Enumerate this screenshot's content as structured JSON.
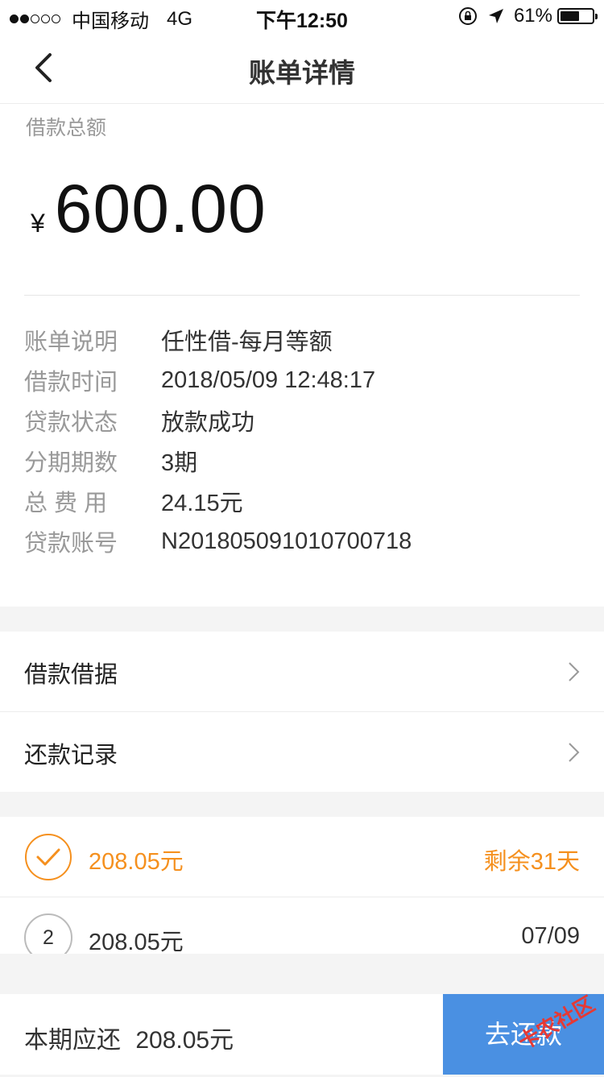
{
  "status_bar": {
    "carrier": "中国移动",
    "network": "4G",
    "time": "下午12:50",
    "battery_percent": "61%",
    "battery_level": 0.61
  },
  "nav": {
    "title": "账单详情"
  },
  "summary": {
    "total_label": "借款总额",
    "currency_symbol": "¥",
    "total_amount": "600.00"
  },
  "details": [
    {
      "label": "账单说明",
      "value": "任性借-每月等额"
    },
    {
      "label": "借款时间",
      "value": "2018/05/09 12:48:17"
    },
    {
      "label": "贷款状态",
      "value": "放款成功"
    },
    {
      "label": "分期期数",
      "value": "3期"
    },
    {
      "label": "总 费 用",
      "value": "24.15元"
    },
    {
      "label": "贷款账号",
      "value": "N201805091010700718"
    }
  ],
  "menu": [
    {
      "label": "借款借据"
    },
    {
      "label": "还款记录"
    }
  ],
  "plans": [
    {
      "amount": "208.05元",
      "right": "剩余31天",
      "status": "current"
    },
    {
      "number": "2",
      "amount": "208.05元",
      "right": "07/09",
      "status": "upcoming"
    }
  ],
  "footer": {
    "due_label": "本期应还",
    "due_amount": "208.05元",
    "pay_button": "去还款"
  },
  "watermark": "卡农社区",
  "colors": {
    "accent_orange": "#f5901e",
    "button_blue": "#4a90e2",
    "label_gray": "#999999",
    "background": "#f4f4f4"
  }
}
